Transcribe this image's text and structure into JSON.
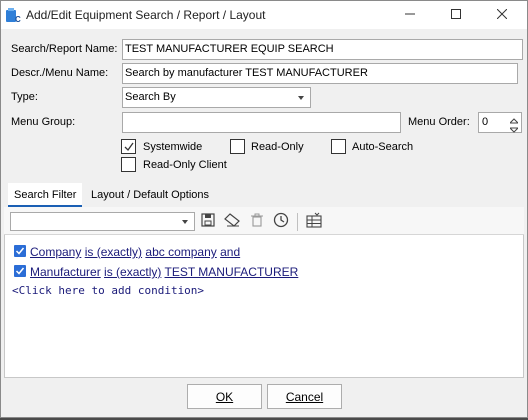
{
  "window": {
    "title": "Add/Edit Equipment Search / Report / Layout",
    "icon_name": "app-search-icon",
    "controls": [
      "minimize-icon",
      "maximize-icon",
      "close-icon"
    ]
  },
  "form": {
    "search_report_name_label": "Search/Report Name:",
    "search_report_name_value": "TEST MANUFACTURER EQUIP SEARCH",
    "descr_menu_name_label": "Descr./Menu Name:",
    "descr_menu_name_value": "Search by manufacturer TEST MANUFACTURER",
    "type_label": "Type:",
    "type_value": "Search By",
    "menu_group_label": "Menu Group:",
    "menu_group_value": "",
    "menu_order_label": "Menu Order:",
    "menu_order_value": "0",
    "checkboxes": {
      "systemwide": {
        "label": "Systemwide",
        "checked": true
      },
      "read_only": {
        "label": "Read-Only",
        "checked": false
      },
      "auto_search": {
        "label": "Auto-Search",
        "checked": false
      },
      "read_only_client": {
        "label": "Read-Only Client",
        "checked": false
      }
    }
  },
  "tabs": {
    "search_filter": "Search Filter",
    "layout_default_options": "Layout / Default Options",
    "active": "search_filter"
  },
  "filter": {
    "saved_filter_value": "",
    "toolbar_icons": [
      "save-icon",
      "eraser-icon",
      "trash-icon",
      "clock-icon",
      "grid-columns-icon"
    ],
    "conditions": [
      {
        "field": "Company",
        "operator": "is (exactly)",
        "value": "abc company",
        "joiner": "and",
        "checked": true
      },
      {
        "field": "Manufacturer",
        "operator": "is (exactly)",
        "value": "TEST MANUFACTURER",
        "joiner": "",
        "checked": true
      }
    ],
    "add_condition_text": "<Click here to add condition>"
  },
  "buttons": {
    "ok": "OK",
    "cancel": "Cancel"
  },
  "colors": {
    "accent": "#1a5fb4",
    "link": "#1b1b7a",
    "checkbox_fill": "#2b6dd6"
  }
}
